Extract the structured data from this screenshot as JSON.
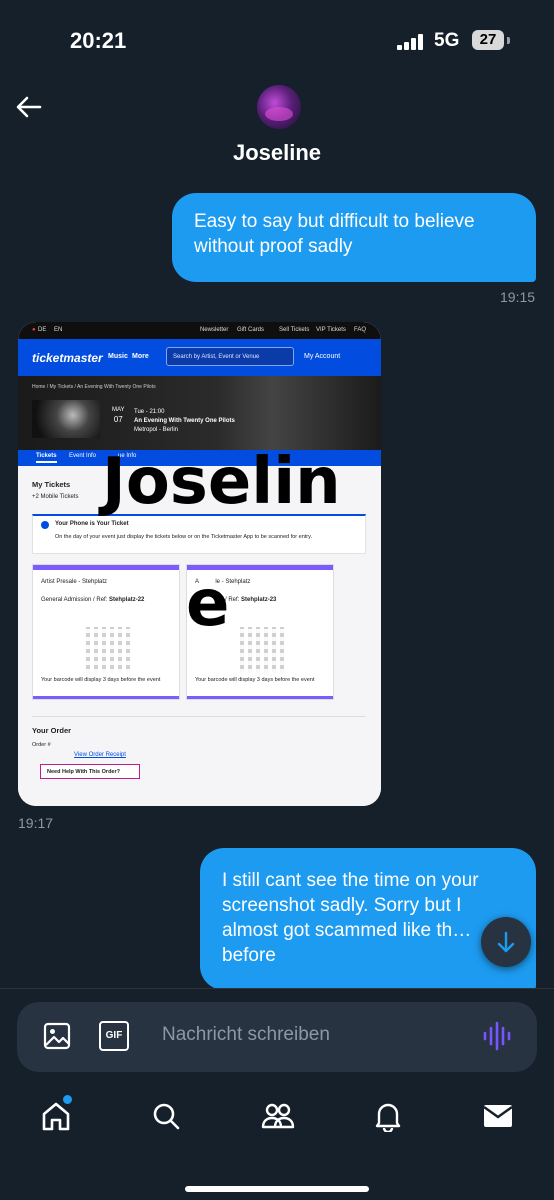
{
  "status_bar": {
    "time": "20:21",
    "network": "5G",
    "battery": "27"
  },
  "header": {
    "contact_name": "Joseline"
  },
  "messages": [
    {
      "text": "Easy to say but difficult to believe without proof sadly",
      "time": "19:15"
    },
    {
      "image_time": "19:17"
    },
    {
      "text": "I still cant see the time on your screenshot sadly. Sorry but I almost got scammed like th… before"
    }
  ],
  "shared_screenshot": {
    "top_bar": {
      "lang_de": "DE",
      "lang_en": "EN",
      "newsletter": "Newsletter",
      "gift_cards": "Gift Cards",
      "sell_tickets": "Sell Tickets",
      "vip_tickets": "VIP Tickets",
      "faq": "FAQ"
    },
    "nav": {
      "logo": "ticketmaster",
      "music": "Music",
      "more": "More",
      "search_placeholder": "Search by Artist, Event or Venue",
      "account": "My Account"
    },
    "breadcrumb": "Home / My Tickets / An Evening With Twenty One Pilots",
    "event": {
      "month": "MAY",
      "day": "07",
      "time": "Tue - 21:00",
      "title": "An Evening With Twenty One Pilots",
      "venue": "Metropol - Berlin"
    },
    "tabs": [
      "Tickets",
      "Event Info",
      "ue Info"
    ],
    "my_tickets": "My Tickets",
    "mobile_tickets": "+2 Mobile Tickets",
    "info_title": "Your Phone is Your Ticket",
    "info_text": "On the day of your event just display the tickets below or on the Ticketmaster App to be scanned for entry.",
    "tickets": [
      {
        "type": "Artist Presale - Stehplatz",
        "ref_label": "General Admission / Ref: ",
        "ref": "Stehplatz-22",
        "barcode_note": "Your barcode will display 3 days before the event"
      },
      {
        "type": "A          le - Stehplatz",
        "ref_label": "             on / Ref: ",
        "ref": "Stehplatz-23",
        "barcode_note": "Your barcode will display 3 days before the event"
      }
    ],
    "order_title": "Your Order",
    "order_number": "Order #",
    "receipt_link": "View Order Receipt",
    "help_button": "Need Help With This Order?",
    "watermark_line1": "Joselin",
    "watermark_line2": "e"
  },
  "composer": {
    "placeholder": "Nachricht schreiben",
    "gif_label": "GIF"
  },
  "icons": [
    "back-arrow-icon",
    "image-icon",
    "gif-icon",
    "voice-icon",
    "scroll-down-icon",
    "home-icon",
    "search-icon",
    "communities-icon",
    "notifications-icon",
    "messages-icon"
  ],
  "colors": {
    "background": "#15202b",
    "bubble": "#1d9bf0",
    "ticketmaster_blue": "#024ddf"
  }
}
